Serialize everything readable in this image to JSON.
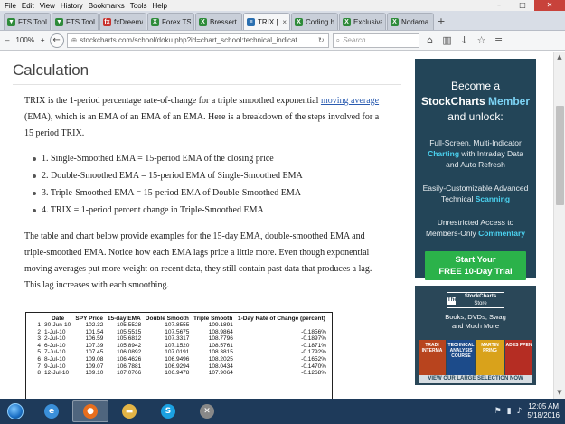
{
  "window": {
    "menu": [
      "File",
      "Edit",
      "View",
      "History",
      "Bookmarks",
      "Tools",
      "Help"
    ],
    "controls": {
      "minimize": "–",
      "maximize": "□",
      "close": "✕"
    }
  },
  "tabs": [
    {
      "label": "FTS Tool...",
      "color": "#2e8b3a",
      "glyph": "▼"
    },
    {
      "label": "FTS Tool...",
      "color": "#2e8b3a",
      "glyph": "▼"
    },
    {
      "label": "fxDreema...",
      "color": "#c8332f",
      "glyph": "fx"
    },
    {
      "label": "Forex TS...",
      "color": "#2e8b3a",
      "glyph": "X"
    },
    {
      "label": "Bressert ...",
      "color": "#2e8b3a",
      "glyph": "X"
    },
    {
      "label": "TRIX [...",
      "color": "#2a6fb0",
      "glyph": "≡",
      "active": true
    },
    {
      "label": "Coding h...",
      "color": "#2e8b3a",
      "glyph": "X"
    },
    {
      "label": "Exclusive ...",
      "color": "#2e8b3a",
      "glyph": "X"
    },
    {
      "label": "Nodama ...",
      "color": "#2e8b3a",
      "glyph": "X"
    }
  ],
  "navbar": {
    "zoom": "100%",
    "url": "stockcharts.com/school/doku.php?id=chart_school:technical_indicat",
    "search_placeholder": "Search"
  },
  "article": {
    "title": "Calculation",
    "para1_pre": "TRIX is the 1-period percentage rate-of-change for a triple smoothed exponential ",
    "para1_link": "moving average",
    "para1_post": " (EMA), which is an EMA of an EMA of an EMA. Here is a breakdown of the steps involved for a 15 period TRIX.",
    "steps": [
      "1. Single-Smoothed EMA = 15-period EMA of the closing price",
      "2. Double-Smoothed EMA = 15-period EMA of Single-Smoothed EMA",
      "3. Triple-Smoothed EMA = 15-period EMA of Double-Smoothed EMA",
      "4. TRIX = 1-period percent change in Triple-Smoothed EMA"
    ],
    "para2": "The table and chart below provide examples for the 15-day EMA, double-smoothed EMA and triple-smoothed EMA. Notice how each EMA lags price a little more. Even though exponential moving averages put more weight on recent data, they still contain past data that produces a lag. This lag increases with each smoothing."
  },
  "ema_table": {
    "headers": [
      "",
      "Date",
      "SPY Price",
      "15-day EMA",
      "Double Smooth",
      "Triple Smooth",
      "1-Day Rate of Change (percent)"
    ],
    "rows": [
      [
        "1",
        "30-Jun-10",
        "102.32",
        "105.5528",
        "107.8555",
        "109.1891",
        ""
      ],
      [
        "2",
        "1-Jul-10",
        "101.54",
        "105.5515",
        "107.5675",
        "108.9864",
        "-0.1856%"
      ],
      [
        "3",
        "2-Jul-10",
        "106.59",
        "105.6812",
        "107.3317",
        "108.7796",
        "-0.1897%"
      ],
      [
        "4",
        "6-Jul-10",
        "107.39",
        "105.8942",
        "107.1520",
        "108.5761",
        "-0.1871%"
      ],
      [
        "5",
        "7-Jul-10",
        "107.45",
        "106.0892",
        "107.0191",
        "108.3815",
        "-0.1792%"
      ],
      [
        "6",
        "8-Jul-10",
        "109.08",
        "106.4626",
        "106.9496",
        "108.2025",
        "-0.1652%"
      ],
      [
        "7",
        "9-Jul-10",
        "109.07",
        "106.7881",
        "106.9294",
        "108.0434",
        "-0.1470%"
      ],
      [
        "8",
        "12-Jul-10",
        "109.10",
        "107.0766",
        "106.9478",
        "107.9064",
        "-0.1268%"
      ]
    ]
  },
  "side_ad": {
    "line1": "Become a",
    "brand": "StockCharts",
    "member": "Member",
    "line3": "and unlock:",
    "f1_pre": "Full-Screen, Multi-Indicator",
    "f1_hl": "Charting",
    "f1_post": "with Intraday Data and Auto Refresh",
    "f2_pre": "Easily-Customizable Advanced Technical",
    "f2_hl": "Scanning",
    "f3_pre": "Unrestricted Access to Members-Only",
    "f3_hl": "Commentary",
    "cta1": "Start Your",
    "cta2": "FREE 10-Day Trial"
  },
  "store_ad": {
    "logo_line1": "The",
    "logo_line2": "StockCharts",
    "logo_line3": "Store",
    "text1": "Books, DVDs, Swag",
    "text2": "and Much More",
    "books": [
      {
        "label": "TRADI INTERMA",
        "color": "#b8441e"
      },
      {
        "label": "TECHNICAL ANALYSIS COURSE",
        "color": "#1c4b8a"
      },
      {
        "label": "MARTIN PRING",
        "color": "#d9a21b"
      },
      {
        "label": "ADES PPEN",
        "color": "#b52d23"
      }
    ],
    "bar": "VIEW OUR LARGE SELECTION NOW"
  },
  "taskbar": {
    "apps": [
      {
        "name": "ie",
        "glyph": "e",
        "color": "#3a8fd9"
      },
      {
        "name": "firefox",
        "glyph": "●",
        "color": "#e76e1e",
        "active": true
      },
      {
        "name": "folder",
        "glyph": "▬",
        "color": "#e3b446"
      },
      {
        "name": "skype",
        "glyph": "S",
        "color": "#1ba1e2"
      },
      {
        "name": "tool",
        "glyph": "✕",
        "color": "#888888"
      }
    ],
    "time": "12:05 AM",
    "date": "5/18/2016"
  }
}
